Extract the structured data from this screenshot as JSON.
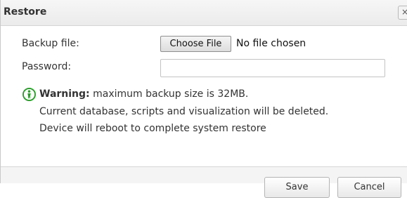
{
  "dialog": {
    "title": "Restore",
    "close_glyph": "×"
  },
  "form": {
    "backup_label": "Backup file:",
    "choose_file_label": "Choose File",
    "file_status": "No file chosen",
    "password_label": "Password:",
    "password_value": ""
  },
  "warning": {
    "icon": "warning-person-icon",
    "icon_color": "#2a9d2a",
    "strong": "Warning:",
    "line1_rest": " maximum backup size is 32MB.",
    "line2": "Current database, scripts and visualization will be deleted.",
    "line3": "Device will reboot to complete system restore"
  },
  "footer": {
    "save_label": "Save",
    "cancel_label": "Cancel"
  }
}
